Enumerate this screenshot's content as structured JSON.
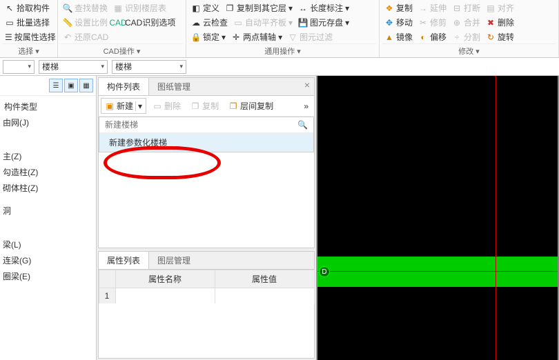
{
  "ribbon": {
    "g1": {
      "pick": "拾取构件",
      "batch": "批量选择",
      "byattr": "按属性选择",
      "title": "选择"
    },
    "g2": {
      "find": "查找替换",
      "layer": "识别楼层表",
      "scale": "设置比例",
      "cadopt": "CAD识别选项",
      "restore": "还原CAD",
      "title": "CAD操作"
    },
    "g3": {
      "define": "定义",
      "copyto": "复制到其它层",
      "length": "长度标注",
      "cloud": "云检查",
      "autoplate": "自动平齐板",
      "imgsave": "图元存盘",
      "lock": "锁定",
      "twoaux": "两点辅轴",
      "imgfilter": "图元过滤",
      "title": "通用操作"
    },
    "g4": {
      "copy": "复制",
      "extend": "延伸",
      "break": "打断",
      "align": "对齐",
      "move": "移动",
      "trim": "修剪",
      "merge": "合并",
      "delete": "删除",
      "mirror": "镜像",
      "offset": "偏移",
      "split": "分割",
      "rotate": "旋转",
      "title": "修改"
    }
  },
  "selectors": {
    "s2": "楼梯",
    "s3": "楼梯"
  },
  "tree": {
    "header1": "构件类型",
    "item_axis": "由网(J)",
    "item_z": "主(Z)",
    "item_gz": "勾造柱(Z)",
    "item_qt": "砌体柱(Z)",
    "item_dong": "洞",
    "item_liang": "梁(L)",
    "item_lianliang": "连梁(G)",
    "item_quanliang": "圈梁(E)"
  },
  "componentPanel": {
    "tab1": "构件列表",
    "tab2": "图纸管理",
    "new": "新建",
    "del": "删除",
    "copy": "复制",
    "layercopy": "层间复制",
    "search_placeholder": "新建楼梯",
    "dropdown_item": "新建参数化楼梯"
  },
  "attrPanel": {
    "tab1": "属性列表",
    "tab2": "图层管理",
    "col1": "属性名称",
    "col2": "属性值",
    "row1": "1"
  },
  "viewport": {
    "marker": "D"
  }
}
